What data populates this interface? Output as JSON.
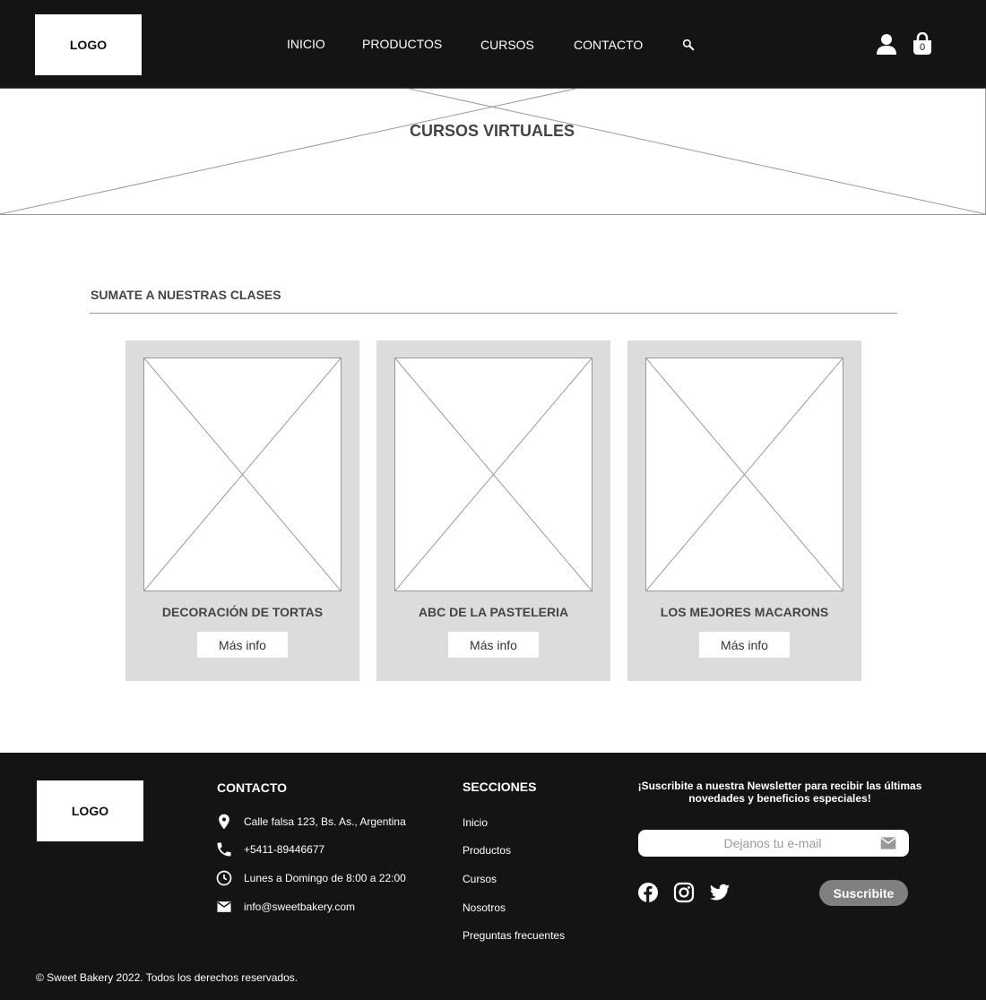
{
  "header": {
    "logo": "LOGO",
    "nav": [
      "INICIO",
      "PRODUCTOS",
      "CURSOS",
      "CONTACTO"
    ],
    "cart_count": "0"
  },
  "hero": {
    "title": "CURSOS VIRTUALES"
  },
  "courses": {
    "section_title": "SUMATE A NUESTRAS CLASES",
    "items": [
      {
        "title": "DECORACIÓN DE TORTAS",
        "button": "Más info"
      },
      {
        "title": "ABC DE LA PASTELERIA",
        "button": "Más info"
      },
      {
        "title": "LOS MEJORES MACARONS",
        "button": "Más info"
      }
    ]
  },
  "footer": {
    "logo": "LOGO",
    "contact": {
      "heading": "CONTACTO",
      "address": "Calle falsa 123, Bs. As., Argentina",
      "phone": "+5411-89446677",
      "hours": "Lunes a Domingo de 8:00 a 22:00",
      "email": "info@sweetbakery.com"
    },
    "sections": {
      "heading": "SECCIONES",
      "links": [
        "Inicio",
        "Productos",
        "Cursos",
        "Nosotros",
        "Preguntas frecuentes"
      ]
    },
    "newsletter": {
      "text": "¡Suscribite a nuestra Newsletter para recibir las últimas novedades y beneficios especiales!",
      "placeholder": "Dejanos tu e-mail",
      "button": "Suscribite"
    },
    "copyright": "© Sweet Bakery 2022. Todos los derechos reservados."
  },
  "icons": {
    "search": "search-icon",
    "user": "user-icon",
    "cart": "shopping-bag-icon",
    "location": "location-pin-icon",
    "phone": "phone-icon",
    "clock": "clock-icon",
    "mail": "mail-icon",
    "facebook": "facebook-icon",
    "instagram": "instagram-icon",
    "twitter": "twitter-icon"
  },
  "colors": {
    "dark": "#141414",
    "card": "#dcdcdc",
    "button_grey": "#808080"
  }
}
